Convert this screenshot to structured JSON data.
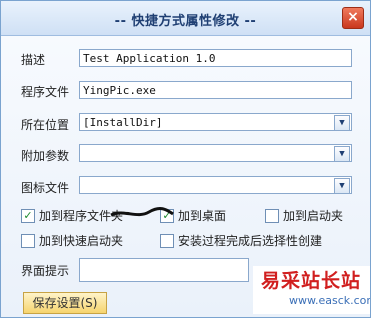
{
  "dialog": {
    "title": "-- 快捷方式属性修改 --",
    "close_icon": "×"
  },
  "fields": {
    "description": {
      "label": "描述",
      "value": "Test Application 1.0"
    },
    "program_file": {
      "label": "程序文件",
      "value": "YingPic.exe"
    },
    "location": {
      "label": "所在位置",
      "value": "[InstallDir]"
    },
    "extra_params": {
      "label": "附加参数",
      "value": ""
    },
    "icon_file": {
      "label": "图标文件",
      "value": ""
    },
    "ui_hint": {
      "label": "界面提示",
      "value": ""
    }
  },
  "options": {
    "add_to_programs": {
      "label": "加到程序文件夹",
      "checked": true
    },
    "add_to_desktop": {
      "label": "加到桌面",
      "checked": true
    },
    "add_to_startup": {
      "label": "加到启动夹",
      "checked": false
    },
    "add_to_quicklaunch": {
      "label": "加到快速启动夹",
      "checked": false
    },
    "choose_after_install": {
      "label": "安装过程完成后选择性创建",
      "checked": false
    }
  },
  "buttons": {
    "save_label": "保存设置(S)"
  },
  "watermark": {
    "text_cn": "易采站长站",
    "url": "www.easck.com"
  },
  "colors": {
    "title": "#1f3f73",
    "close": "#d9472a",
    "check": "#1d8a2e",
    "watermark": "#d11f1f"
  }
}
